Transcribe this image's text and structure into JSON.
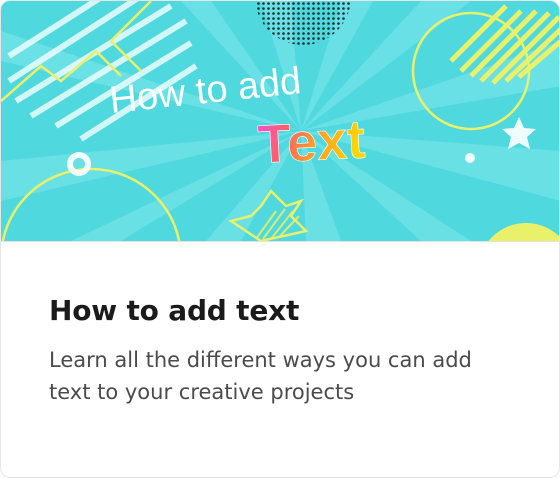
{
  "banner": {
    "line1": "How to add",
    "line2": "Text",
    "colors": {
      "background": "#4fd9df",
      "ray": "#74e3e7",
      "accent_yellow": "#e9f06a",
      "white": "#ffffff"
    }
  },
  "card": {
    "title": "How to add text",
    "description": "Learn all the different ways you can add text to your creative projects"
  }
}
